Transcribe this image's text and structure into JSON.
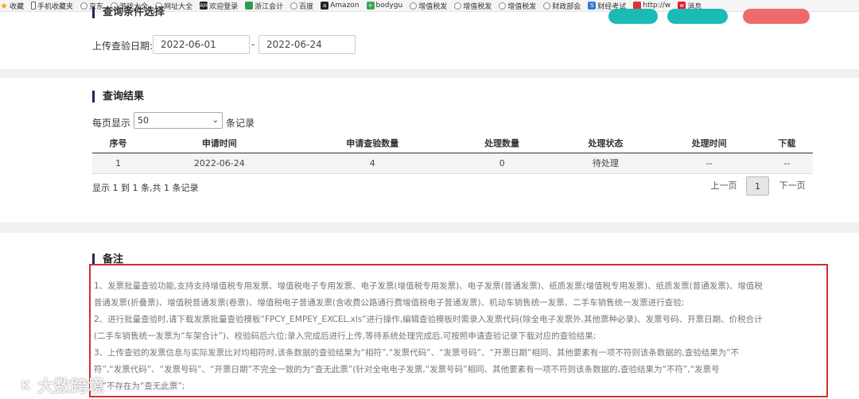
{
  "bookmarks": [
    {
      "label": "收藏",
      "icon": "star-icon"
    },
    {
      "label": "手机收藏夹",
      "icon": "phone-icon"
    },
    {
      "label": "京东",
      "icon": "globe-icon"
    },
    {
      "label": "游戏大全",
      "icon": "globe-icon"
    },
    {
      "label": "网址大全",
      "icon": "globe-icon"
    },
    {
      "label": "欢迎登录",
      "icon": "ah-icon"
    },
    {
      "label": "浙江会计",
      "icon": "doc-icon"
    },
    {
      "label": "百度",
      "icon": "globe-icon"
    },
    {
      "label": "Amazon",
      "icon": "amazon-icon"
    },
    {
      "label": "bodygu",
      "icon": "plus-icon"
    },
    {
      "label": "增值税发",
      "icon": "globe-icon"
    },
    {
      "label": "增值税发",
      "icon": "globe-icon"
    },
    {
      "label": "增值税发",
      "icon": "globe-icon"
    },
    {
      "label": "财政部会",
      "icon": "globe-icon"
    },
    {
      "label": "财经考试",
      "icon": "s-icon"
    },
    {
      "label": "http://w",
      "icon": "red-icon"
    },
    {
      "label": "消息",
      "icon": "weibo-icon"
    }
  ],
  "colors": {
    "teal": "#1bbbb5",
    "red": "#ef6b6b",
    "notes_border": "#d03030",
    "title_bar": "#1c2a4a"
  },
  "query": {
    "title": "查询条件选择",
    "date_label": "上传查验日期:",
    "date_from": "2022-06-01",
    "date_to": "2022-06-24",
    "separator": "-"
  },
  "results": {
    "title": "查询结果",
    "per_page_prefix": "每页显示",
    "per_page_value": "50",
    "per_page_suffix": "条记录",
    "headers": [
      "序号",
      "申请时间",
      "申请查验数量",
      "处理数量",
      "处理状态",
      "处理时间",
      "下载"
    ],
    "rows": [
      [
        "1",
        "2022-06-24",
        "4",
        "0",
        "待处理",
        "--",
        "--"
      ]
    ],
    "info": "显示 1 到 1 条,共 1 条记录",
    "pagination": {
      "prev": "上一页",
      "current": "1",
      "next": "下一页"
    }
  },
  "notes": {
    "title": "备注",
    "lines": [
      "1、发票批量查验功能,支持支持增值税专用发票、增值税电子专用发票、电子发票(增值税专用发票)、电子发票(普通发票)、纸质发票(增值税专用发票)、纸质发票(普通发票)、增值税",
      "普通发票(折叠票)、增值税普通发票(卷票)、增值税电子普通发票(含收费公路通行费增值税电子普通发票)、机动车销售统一发票、二手车销售统一发票进行查验;",
      "2、进行批量查验时,请下载发票批量查验模板“FPCY_EMPEY_EXCEL.xls”进行操作,编辑查验模板时需录入发票代码(除全电子发票外,其他票种必录)、发票号码、开票日期、价税合计",
      "(二手车销售统一发票为“车架合计”)、校验码后六位;录入完成后进行上传,等待系统处理完成后,可按照申请查验记录下载对应的查验结果;",
      "3、上传查验的发票信息与实际发票比对均相符时,该条数据的查验结果为“相符”,“发票代码”、“发票号码”、“开票日期”相同、其他要素有一项不符则该条数据的,查验结果为“不",
      "符”,“发票代码”、“发票号码”、“开票日期”不完全一致的为“查无此票”(针对全电电子发票,“发票号码”相同、其他要素有一项不符则该条数据的,查验结果为“不符”,“发票号",
      "码”不存在为“查无此票”;"
    ]
  },
  "watermark": {
    "logo": "K",
    "text": "大数跨境"
  }
}
